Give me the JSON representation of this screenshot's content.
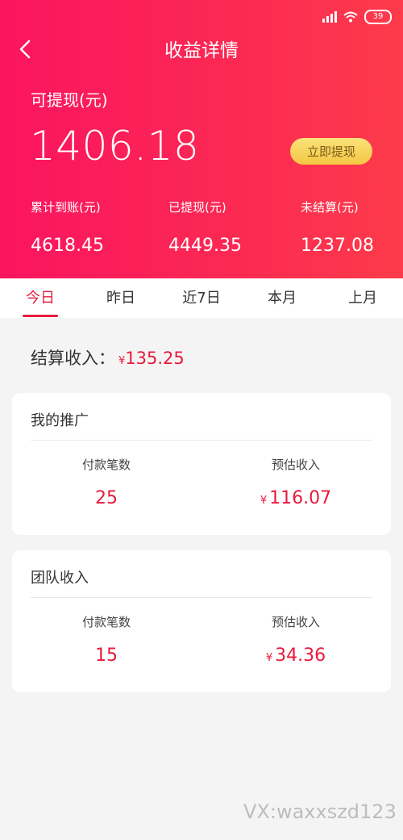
{
  "status_bar": {
    "battery": "39"
  },
  "header": {
    "title": "收益详情",
    "withdrawable_label": "可提现(元)",
    "withdrawable_amount": "1406.18",
    "withdraw_button": "立即提现",
    "stats": [
      {
        "label": "累计到账(元)",
        "value": "4618.45"
      },
      {
        "label": "已提现(元)",
        "value": "4449.35"
      },
      {
        "label": "未结算(元)",
        "value": "1237.08"
      }
    ]
  },
  "tabs": [
    "今日",
    "昨日",
    "近7日",
    "本月",
    "上月"
  ],
  "active_tab": "今日",
  "settled": {
    "label": "结算收入：",
    "currency": "¥",
    "amount": "135.25"
  },
  "cards": {
    "promotion": {
      "title": "我的推广",
      "count_label": "付款笔数",
      "count_value": "25",
      "income_label": "预估收入",
      "currency": "¥",
      "income_value": "116.07"
    },
    "team": {
      "title": "团队收入",
      "count_label": "付款笔数",
      "count_value": "15",
      "income_label": "预估收入",
      "currency": "¥",
      "income_value": "34.36"
    }
  },
  "watermark": "VX:waxxszd123",
  "colors": {
    "accent": "#e81a3c",
    "header_start": "#fb1460",
    "header_end": "#fd3b4a",
    "button_gold": "#f3c743"
  },
  "icons": [
    "back-icon",
    "signal-icon",
    "wifi-icon",
    "battery-icon"
  ]
}
